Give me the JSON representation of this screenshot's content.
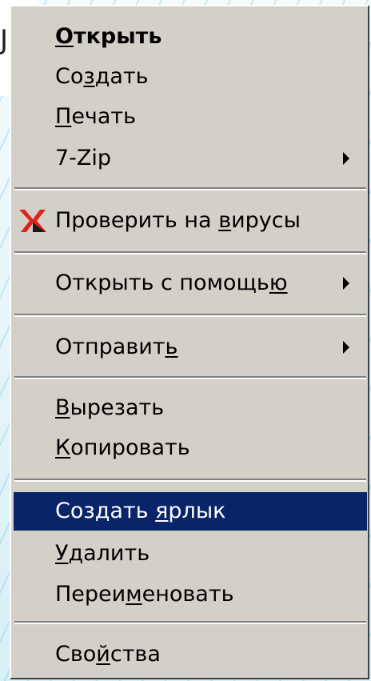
{
  "context_menu": {
    "items": [
      {
        "id": "open",
        "pre": "",
        "accel": "О",
        "post": "ткрыть"
      },
      {
        "id": "create",
        "pre": "Со",
        "accel": "з",
        "post": "дать"
      },
      {
        "id": "print",
        "pre": "",
        "accel": "П",
        "post": "ечать"
      },
      {
        "id": "7zip",
        "pre": "7-Zip",
        "accel": "",
        "post": ""
      },
      {
        "id": "scan",
        "pre": "Проверить на ",
        "accel": "в",
        "post": "ирусы"
      },
      {
        "id": "open-with",
        "pre": "Открыть с помощь",
        "accel": "ю",
        "post": ""
      },
      {
        "id": "send-to",
        "pre": "Отправит",
        "accel": "ь",
        "post": ""
      },
      {
        "id": "cut",
        "pre": "",
        "accel": "В",
        "post": "ырезать"
      },
      {
        "id": "copy",
        "pre": "",
        "accel": "К",
        "post": "опировать"
      },
      {
        "id": "create-shortcut",
        "pre": "Создать ",
        "accel": "я",
        "post": "рлык"
      },
      {
        "id": "delete",
        "pre": "",
        "accel": "У",
        "post": "далить"
      },
      {
        "id": "rename",
        "pre": "Переи",
        "accel": "м",
        "post": "еновать"
      },
      {
        "id": "properties",
        "pre": "Сво",
        "accel": "й",
        "post": "ства"
      }
    ],
    "selected": "create-shortcut",
    "default_item": "open",
    "submenu_items": [
      "7zip",
      "open-with",
      "send-to"
    ],
    "icons": {
      "scan": "kaspersky-icon"
    }
  },
  "background_glyph": "J",
  "colors": {
    "menu_bg": "#d4d0c8",
    "highlight_bg": "#0a246a",
    "highlight_text": "#ffffff",
    "kaspersky_red": "#e0201b"
  }
}
